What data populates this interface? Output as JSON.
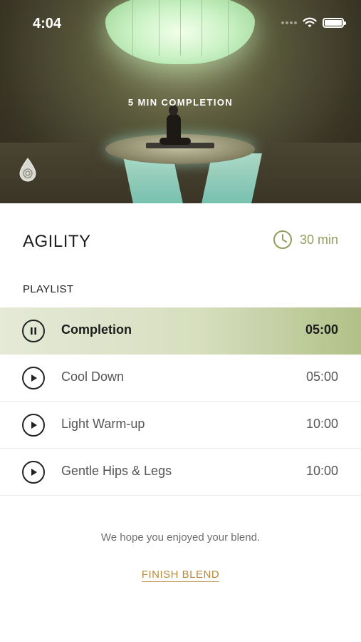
{
  "status_bar": {
    "time": "4:04"
  },
  "hero": {
    "caption": "5 MIN COMPLETION"
  },
  "workout": {
    "title": "AGILITY",
    "duration": "30 min"
  },
  "playlist": {
    "label": "PLAYLIST",
    "tracks": [
      {
        "name": "Completion",
        "time": "05:00",
        "state": "playing"
      },
      {
        "name": "Cool Down",
        "time": "05:00",
        "state": "paused"
      },
      {
        "name": "Light Warm-up",
        "time": "10:00",
        "state": "paused"
      },
      {
        "name": "Gentle Hips & Legs",
        "time": "10:00",
        "state": "paused"
      }
    ]
  },
  "footer": {
    "message": "We hope you enjoyed your blend.",
    "finish_label": "FINISH BLEND"
  },
  "colors": {
    "accent_green": "#8f9d5e",
    "accent_gold": "#b58a3c",
    "active_row": "#d7dfbf"
  },
  "icons": [
    "wifi-icon",
    "battery-icon",
    "drop-logo-icon",
    "clock-icon",
    "pause-icon",
    "play-icon"
  ]
}
